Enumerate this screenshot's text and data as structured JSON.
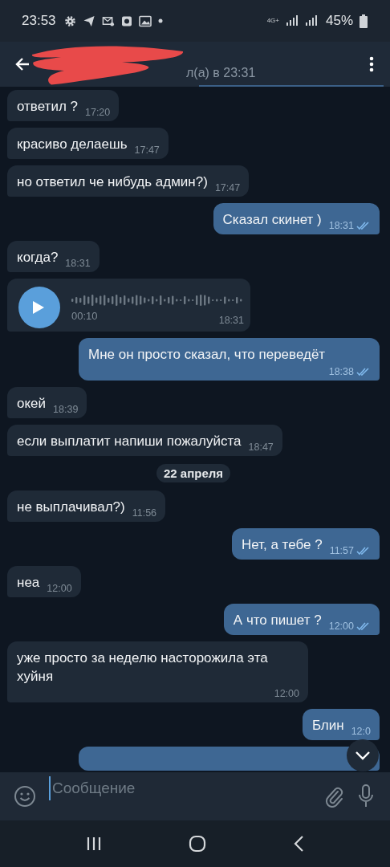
{
  "status_bar": {
    "time": "23:53",
    "network": "4G+",
    "battery": "45%"
  },
  "header": {
    "subtitle": "л(а) в 23:31",
    "name_hidden": true
  },
  "messages": [
    {
      "kind": "text",
      "outgoing": false,
      "text": "ответил ?",
      "time": "17:20"
    },
    {
      "kind": "text",
      "outgoing": false,
      "text": "красиво делаешь",
      "time": "17:47"
    },
    {
      "kind": "text",
      "outgoing": false,
      "text": "но ответил че нибудь админ?)",
      "time": "17:47"
    },
    {
      "kind": "text",
      "outgoing": true,
      "text": "Сказал скинет )",
      "time": "18:31",
      "read": true
    },
    {
      "kind": "text",
      "outgoing": false,
      "text": "когда?",
      "time": "18:31"
    },
    {
      "kind": "voice",
      "outgoing": false,
      "duration": "00:10",
      "time": "18:31"
    },
    {
      "kind": "text",
      "outgoing": true,
      "text": "Мне он просто сказал, что переведёт",
      "time": "18:38",
      "read": true
    },
    {
      "kind": "text",
      "outgoing": false,
      "text": "окей",
      "time": "18:39"
    },
    {
      "kind": "text",
      "outgoing": false,
      "text": "если выплатит напиши пожалуйста",
      "time": "18:47"
    },
    {
      "kind": "date",
      "text": "22 апреля"
    },
    {
      "kind": "text",
      "outgoing": false,
      "text": "не выплачивал?)",
      "time": "11:56"
    },
    {
      "kind": "text",
      "outgoing": true,
      "text": "Нет, а тебе ?",
      "time": "11:57",
      "read": true
    },
    {
      "kind": "text",
      "outgoing": false,
      "text": "неа",
      "time": "12:00"
    },
    {
      "kind": "text",
      "outgoing": true,
      "text": "А что пишет ?",
      "time": "12:00",
      "read": true
    },
    {
      "kind": "text",
      "outgoing": false,
      "text": "уже просто за неделю насторожила эта хуйня",
      "time": "12:00"
    },
    {
      "kind": "text",
      "outgoing": true,
      "text": "Блин",
      "time": "12:0"
    },
    {
      "kind": "partial",
      "outgoing": true
    }
  ],
  "composer": {
    "placeholder": "Сообщение"
  }
}
